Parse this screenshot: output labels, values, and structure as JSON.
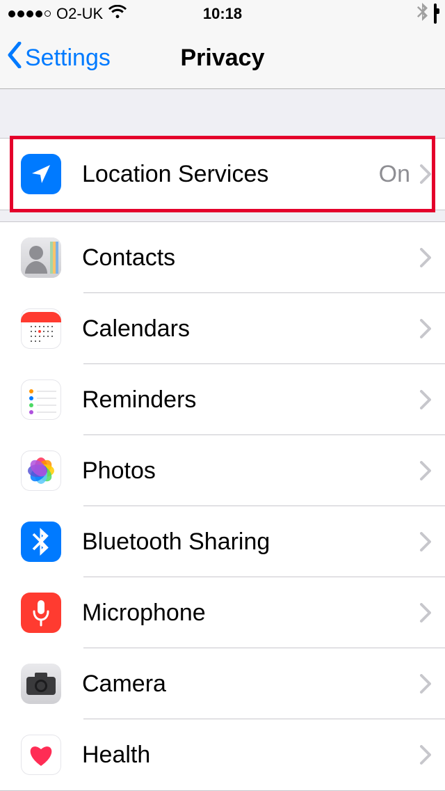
{
  "status": {
    "carrier": "O2-UK",
    "time": "10:18"
  },
  "nav": {
    "back_label": "Settings",
    "title": "Privacy"
  },
  "rows": [
    {
      "id": "location",
      "label": "Location Services",
      "value": "On"
    },
    {
      "id": "contacts",
      "label": "Contacts"
    },
    {
      "id": "calendars",
      "label": "Calendars"
    },
    {
      "id": "reminders",
      "label": "Reminders"
    },
    {
      "id": "photos",
      "label": "Photos"
    },
    {
      "id": "bluetooth",
      "label": "Bluetooth Sharing"
    },
    {
      "id": "microphone",
      "label": "Microphone"
    },
    {
      "id": "camera",
      "label": "Camera"
    },
    {
      "id": "health",
      "label": "Health"
    }
  ],
  "highlight": {
    "target": "location"
  }
}
